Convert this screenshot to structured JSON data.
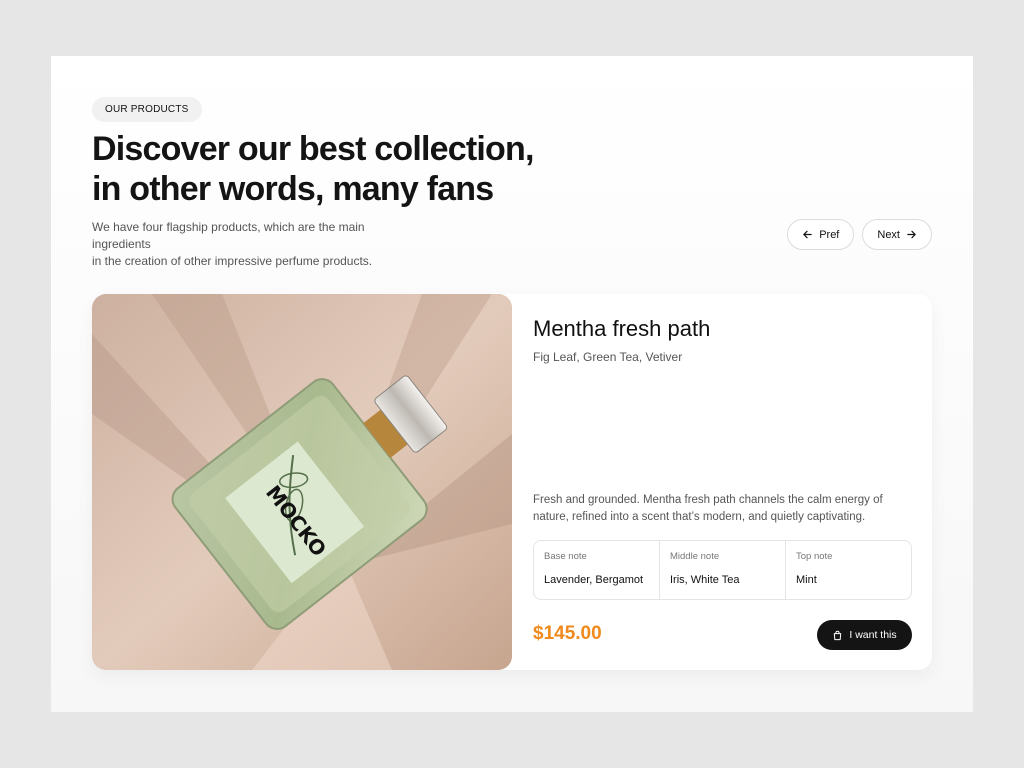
{
  "header": {
    "badge": "OUR PRODUCTS",
    "title_line1": "Discover our best collection,",
    "title_line2": "in other words, many fans",
    "subtitle_line1": "We have four flagship products, which are the main ingredients",
    "subtitle_line2": "in the creation of other impressive perfume products."
  },
  "nav": {
    "prev_label": "Pref",
    "next_label": "Next"
  },
  "product": {
    "name": "Mentha fresh path",
    "notes_summary": "Fig Leaf, Green Tea, Vetiver",
    "description": "Fresh and grounded. Mentha fresh path channels the calm energy of nature, refined into a scent that’s modern, and quietly captivating.",
    "notes": [
      {
        "label": "Base note",
        "value": "Lavender, Bergamot"
      },
      {
        "label": "Middle note",
        "value": "Iris, White Tea"
      },
      {
        "label": "Top note",
        "value": "Mint"
      }
    ],
    "price": "$145.00",
    "buy_label": "I want this",
    "bottle_brand": "MOCKO"
  },
  "colors": {
    "accent": "#f08a1c",
    "button_dark": "#141414"
  },
  "icons": {
    "prev": "arrow-left-icon",
    "next": "arrow-right-icon",
    "buy": "shopping-bag-icon"
  }
}
